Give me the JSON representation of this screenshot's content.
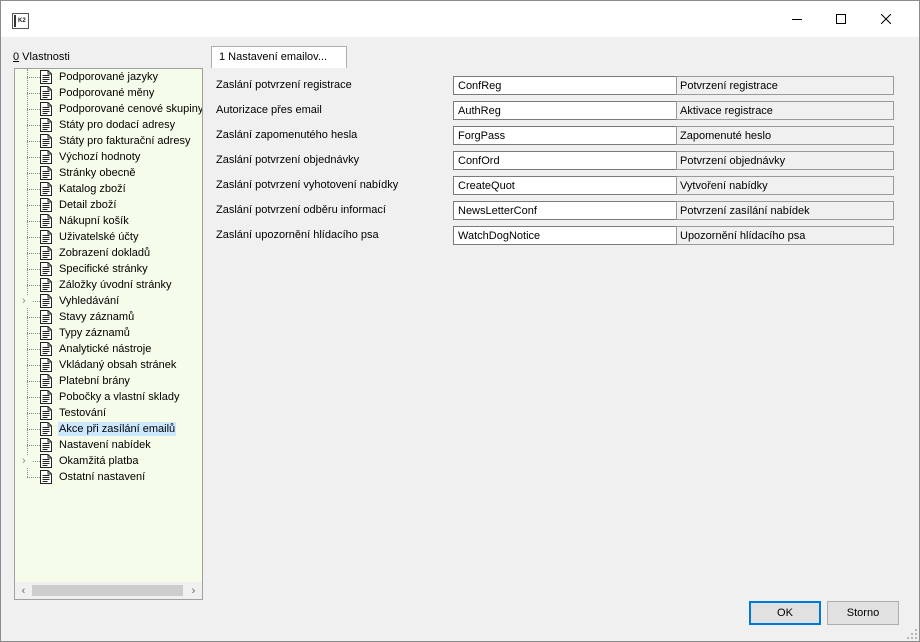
{
  "window": {
    "app_icon": "k2-app-icon",
    "controls": {
      "minimize": "minimize-icon",
      "maximize": "maximize-icon",
      "close": "close-icon"
    }
  },
  "properties": {
    "hotkey": "0",
    "label": " Vlastnosti"
  },
  "tree": {
    "items": [
      {
        "label": "Podporované jazyky",
        "expandable": false,
        "selected": false
      },
      {
        "label": "Podporované měny",
        "expandable": false,
        "selected": false
      },
      {
        "label": "Podporované cenové skupiny",
        "expandable": false,
        "selected": false
      },
      {
        "label": "Státy pro dodací adresy",
        "expandable": false,
        "selected": false
      },
      {
        "label": "Státy pro fakturační adresy",
        "expandable": false,
        "selected": false
      },
      {
        "label": "Výchozí hodnoty",
        "expandable": false,
        "selected": false
      },
      {
        "label": "Stránky obecně",
        "expandable": false,
        "selected": false
      },
      {
        "label": "Katalog zboží",
        "expandable": false,
        "selected": false
      },
      {
        "label": "Detail zboží",
        "expandable": false,
        "selected": false
      },
      {
        "label": "Nákupní košík",
        "expandable": false,
        "selected": false
      },
      {
        "label": "Uživatelské účty",
        "expandable": false,
        "selected": false
      },
      {
        "label": "Zobrazení dokladů",
        "expandable": false,
        "selected": false
      },
      {
        "label": "Specifické stránky",
        "expandable": false,
        "selected": false
      },
      {
        "label": "Záložky úvodní stránky",
        "expandable": false,
        "selected": false
      },
      {
        "label": "Vyhledávání",
        "expandable": true,
        "selected": false
      },
      {
        "label": "Stavy záznamů",
        "expandable": false,
        "selected": false
      },
      {
        "label": "Typy záznamů",
        "expandable": false,
        "selected": false
      },
      {
        "label": "Analytické nástroje",
        "expandable": false,
        "selected": false
      },
      {
        "label": "Vkládaný obsah stránek",
        "expandable": false,
        "selected": false
      },
      {
        "label": "Platební brány",
        "expandable": false,
        "selected": false
      },
      {
        "label": "Pobočky a vlastní sklady",
        "expandable": false,
        "selected": false
      },
      {
        "label": "Testování",
        "expandable": false,
        "selected": false
      },
      {
        "label": "Akce při zasílání emailů",
        "expandable": false,
        "selected": true
      },
      {
        "label": "Nastavení nabídek",
        "expandable": false,
        "selected": false
      },
      {
        "label": "Okamžitá platba",
        "expandable": true,
        "selected": false
      },
      {
        "label": "Ostatní nastavení",
        "expandable": false,
        "selected": false
      }
    ]
  },
  "tab": {
    "label": "1 Nastavení emailov..."
  },
  "email_settings": [
    {
      "label": "Zaslání potvrzení registrace",
      "value": "ConfReg",
      "description": "Potvrzení registrace"
    },
    {
      "label": "Autorizace přes email",
      "value": "AuthReg",
      "description": "Aktivace registrace"
    },
    {
      "label": "Zaslání zapomenutého hesla",
      "value": "ForgPass",
      "description": "Zapomenuté heslo"
    },
    {
      "label": "Zaslání potvrzení objednávky",
      "value": "ConfOrd",
      "description": "Potvrzení objednávky"
    },
    {
      "label": "Zaslání potvrzení vyhotovení nabídky",
      "value": "CreateQuot",
      "description": "Vytvoření nabídky"
    },
    {
      "label": "Zaslání potvrzení odběru informací",
      "value": "NewsLetterConf",
      "description": "Potvrzení zasílání nabídek"
    },
    {
      "label": "Zaslání upozornění hlídacího psa",
      "value": "WatchDogNotice",
      "description": "Upozornění hlídacího psa"
    }
  ],
  "buttons": {
    "ok": "OK",
    "cancel": "Storno"
  },
  "colors": {
    "tree_bg": "#f5fdea",
    "selection": "#cce8ff",
    "default_button_border": "#0078d7"
  }
}
